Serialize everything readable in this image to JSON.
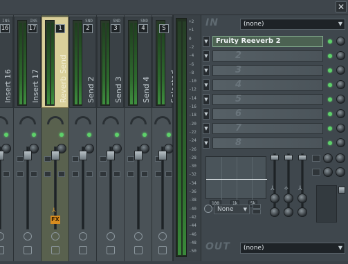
{
  "window": {
    "close_label": "✕"
  },
  "strips": [
    {
      "label": "Insert 16",
      "number": "16",
      "tag": "INS",
      "active": false
    },
    {
      "label": "Insert 17",
      "number": "17",
      "tag": "INS",
      "active": false
    },
    {
      "label": "Reverb Send",
      "number": "1",
      "tag": "",
      "active": true
    },
    {
      "label": "Send 2",
      "number": "2",
      "tag": "SND",
      "active": false
    },
    {
      "label": "Send 3",
      "number": "3",
      "tag": "SND",
      "active": false
    },
    {
      "label": "Send 4",
      "number": "4",
      "tag": "SND",
      "active": false
    },
    {
      "label": "Selected",
      "number": "S",
      "tag": "",
      "active": false
    }
  ],
  "fx_badge": "FX",
  "db_scale": [
    "+2",
    "+1",
    "0",
    "-2",
    "-4",
    "-6",
    "-8",
    "-10",
    "-12",
    "-14",
    "-16",
    "-18",
    "-20",
    "-22",
    "-24",
    "-26",
    "-28",
    "-30",
    "-32",
    "-34",
    "-36",
    "-38",
    "-40",
    "-42",
    "-44",
    "-46",
    "-48",
    "-50"
  ],
  "right_panel": {
    "in_label": "IN",
    "in_value": "(none)",
    "out_label": "OUT",
    "out_value": "(none)",
    "slots": [
      {
        "name": "Fruity Reeverb 2",
        "number": ""
      },
      {
        "name": "",
        "number": "2"
      },
      {
        "name": "",
        "number": "3"
      },
      {
        "name": "",
        "number": "4"
      },
      {
        "name": "",
        "number": "5"
      },
      {
        "name": "",
        "number": "6"
      },
      {
        "name": "",
        "number": "7"
      },
      {
        "name": "",
        "number": "8"
      }
    ],
    "eq_ticks": [
      "100",
      "1k",
      "5k"
    ],
    "preset_value": "None"
  },
  "colors": {
    "accent": "#d9cf9a",
    "led": "#5ed16a",
    "fx_badge": "#d88c1f"
  }
}
